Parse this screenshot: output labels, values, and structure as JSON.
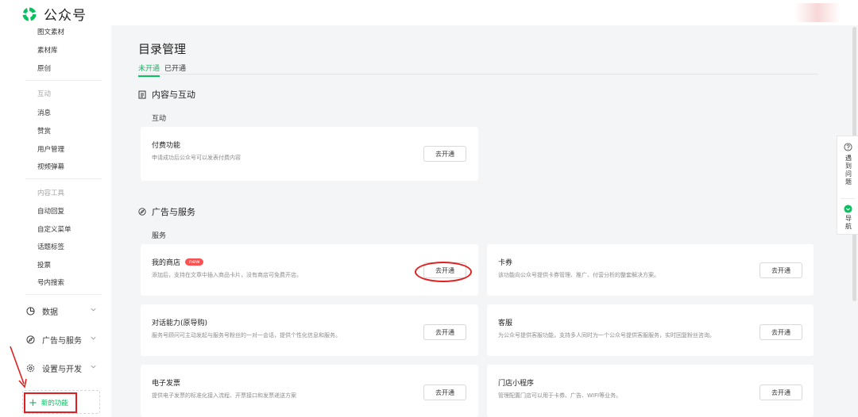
{
  "app": {
    "title": "公众号"
  },
  "sidebar": {
    "items_top": [
      "图文素材",
      "素材库",
      "原创"
    ],
    "group_interaction": "互动",
    "items_interaction": [
      "消息",
      "赞赏",
      "用户管理",
      "视频弹幕"
    ],
    "group_tools": "内容工具",
    "items_tools": [
      "自动回复",
      "自定义菜单",
      "话题标签",
      "投票",
      "号内搜索"
    ],
    "sections": [
      "数据",
      "广告与服务",
      "设置与开发"
    ],
    "new_feature": "新的功能"
  },
  "main": {
    "title": "目录管理",
    "tabs": [
      "未开通",
      "已开通"
    ],
    "section1": {
      "title": "内容与互动",
      "subtitle": "互动"
    },
    "section2": {
      "title": "广告与服务",
      "subtitle": "服务"
    },
    "button_label": "去开通",
    "cards": [
      {
        "title": "付费功能",
        "desc": "申请成功后公众号可以发表付费内容"
      },
      {
        "title": "我的商店",
        "badge": "new",
        "desc": "添加后，支持在文章中插入商品卡片，没有商店可免费开店。"
      },
      {
        "title": "卡券",
        "desc": "该功能向公众号提供卡券管理、推广、付营分析的整套解决方案。"
      },
      {
        "title": "对话能力(原导购)",
        "desc": "服务号顾问可主动发起与服务号粉丝的一对一会话，提供个性化信息和服务。"
      },
      {
        "title": "客服",
        "desc": "为公众号提供客服功能，支持多人同时为一个公众号提供客服服务，实时回复粉丝咨询。"
      },
      {
        "title": "电子发票",
        "desc": "提供电子发票的标准化接入流程、开票接口和发票递送方案"
      },
      {
        "title": "门店小程序",
        "desc": "管理配置门店可以用于卡券、广告、WIFI等业务。"
      }
    ]
  },
  "float_panel": {
    "help": "遇到问题",
    "nav": "导航"
  },
  "colors": {
    "accent": "#07c160",
    "highlight": "#e02020",
    "badge": "#fa5151"
  }
}
